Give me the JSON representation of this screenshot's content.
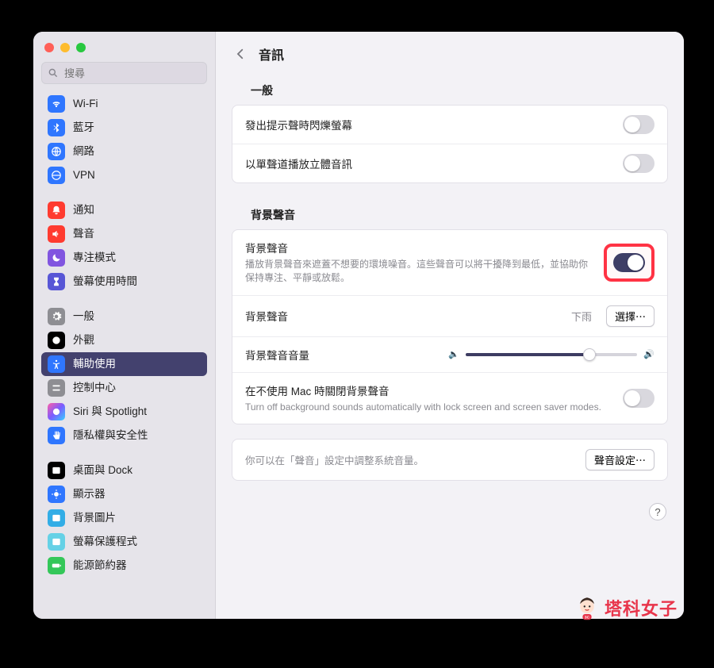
{
  "search": {
    "placeholder": "搜尋"
  },
  "header": {
    "title": "音訊"
  },
  "sidebar": {
    "g1": [
      {
        "label": "Wi-Fi"
      },
      {
        "label": "藍牙"
      },
      {
        "label": "網路"
      },
      {
        "label": "VPN"
      }
    ],
    "g2": [
      {
        "label": "通知"
      },
      {
        "label": "聲音"
      },
      {
        "label": "專注模式"
      },
      {
        "label": "螢幕使用時間"
      }
    ],
    "g3": [
      {
        "label": "一般"
      },
      {
        "label": "外觀"
      },
      {
        "label": "輔助使用"
      },
      {
        "label": "控制中心"
      },
      {
        "label": "Siri 與 Spotlight"
      },
      {
        "label": "隱私權與安全性"
      }
    ],
    "g4": [
      {
        "label": "桌面與 Dock"
      },
      {
        "label": "顯示器"
      },
      {
        "label": "背景圖片"
      },
      {
        "label": "螢幕保護程式"
      },
      {
        "label": "能源節約器"
      }
    ]
  },
  "sections": {
    "general_title": "一般",
    "bg_title": "背景聲音",
    "flash_label": "發出提示聲時閃爍螢幕",
    "mono_label": "以單聲道播放立體音訊",
    "bg_enable_label": "背景聲音",
    "bg_enable_sub": "播放背景聲音來遮蓋不想要的環境噪音。這些聲音可以將干擾降到最低，並協助你保持專注、平靜或放鬆。",
    "bg_sound_label": "背景聲音",
    "bg_sound_value": "下雨",
    "bg_sound_button": "選擇⋯",
    "bg_volume_label": "背景聲音音量",
    "bg_off_label": "在不使用 Mac 時關閉背景聲音",
    "bg_off_sub": "Turn off background sounds automatically with lock screen and screen saver modes.",
    "footnote": "你可以在「聲音」設定中調整系統音量。",
    "sound_settings_button": "聲音設定⋯",
    "help": "?"
  },
  "watermark": {
    "text": "塔科女子"
  }
}
